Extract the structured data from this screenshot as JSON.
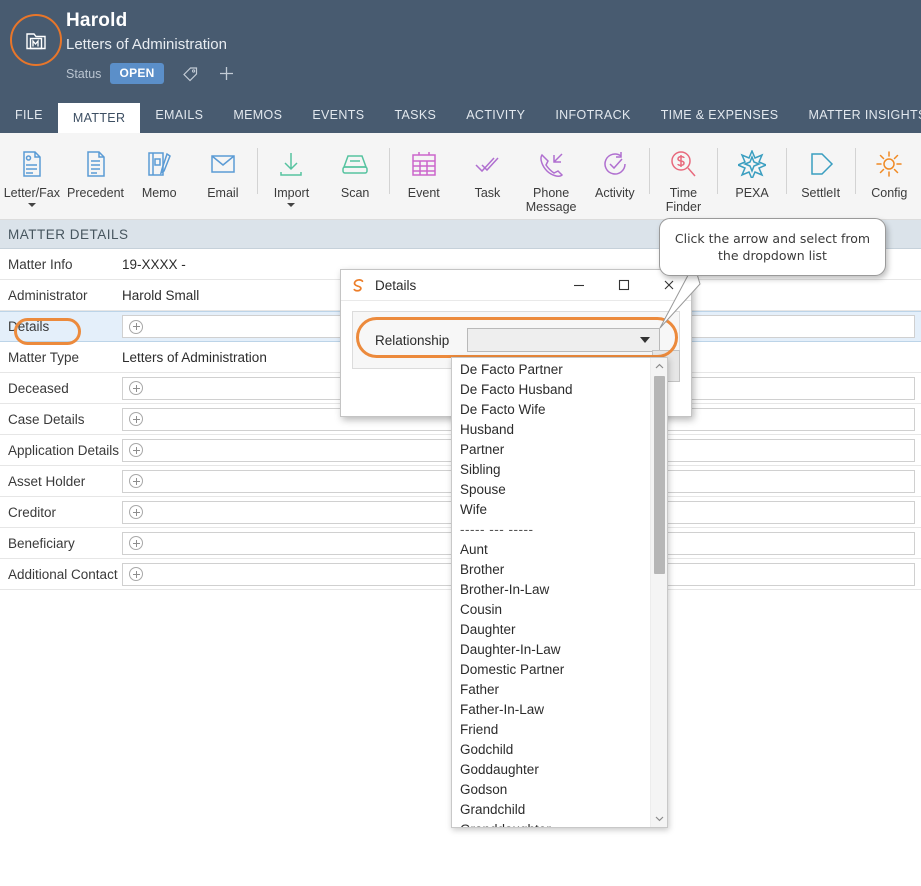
{
  "header": {
    "matter_name": "Harold",
    "matter_type": "Letters of Administration",
    "status_label": "Status",
    "status_value": "OPEN",
    "avatar_icon": "matter-folder-icon",
    "tag_icon": "tag-icon",
    "add_icon": "plus-icon",
    "bg_color": "#485b70",
    "accent_color": "#e8762a",
    "badge_color": "#5b8fc9"
  },
  "tabs": [
    {
      "label": "FILE",
      "active": false
    },
    {
      "label": "MATTER",
      "active": true
    },
    {
      "label": "EMAILS",
      "active": false
    },
    {
      "label": "MEMOS",
      "active": false
    },
    {
      "label": "EVENTS",
      "active": false
    },
    {
      "label": "TASKS",
      "active": false
    },
    {
      "label": "ACTIVITY",
      "active": false
    },
    {
      "label": "INFOTRACK",
      "active": false
    },
    {
      "label": "TIME & EXPENSES",
      "active": false
    },
    {
      "label": "MATTER INSIGHTS",
      "active": false
    }
  ],
  "ribbon": [
    {
      "label": "Letter/Fax",
      "icon": "document-letter-icon",
      "color": "#5b9bd5",
      "caret": true
    },
    {
      "label": "Precedent",
      "icon": "document-lines-icon",
      "color": "#5b9bd5",
      "caret": false
    },
    {
      "label": "Memo",
      "icon": "notebook-pen-icon",
      "color": "#5b9bd5",
      "caret": false
    },
    {
      "label": "Email",
      "icon": "envelope-icon",
      "color": "#5b9bd5",
      "caret": false
    },
    {
      "sep": true
    },
    {
      "label": "Import",
      "icon": "download-arrow-icon",
      "color": "#56c3a0",
      "caret": true
    },
    {
      "label": "Scan",
      "icon": "scanner-icon",
      "color": "#56c3a0",
      "caret": false
    },
    {
      "sep": true
    },
    {
      "label": "Event",
      "icon": "calendar-icon",
      "color": "#cc66cc",
      "caret": false
    },
    {
      "label": "Task",
      "icon": "double-check-icon",
      "color": "#b06fd0",
      "caret": false
    },
    {
      "label": "Phone Message",
      "icon": "phone-incoming-icon",
      "color": "#b06fd0",
      "caret": false
    },
    {
      "label": "Activity",
      "icon": "clock-check-icon",
      "color": "#b06fd0",
      "caret": false
    },
    {
      "sep": true
    },
    {
      "label": "Time Finder",
      "icon": "dollar-magnifier-icon",
      "color": "#e8697d",
      "caret": false
    },
    {
      "sep": true
    },
    {
      "label": "PEXA",
      "icon": "pexa-star-icon",
      "color": "#3a9ec0",
      "caret": false
    },
    {
      "sep": true
    },
    {
      "label": "SettleIt",
      "icon": "arrow-right-flag-icon",
      "color": "#3a9ec0",
      "caret": false
    },
    {
      "sep": true
    },
    {
      "label": "Config",
      "icon": "gear-icon",
      "color": "#f08a24",
      "caret": false
    }
  ],
  "matter_details": {
    "section_title": "MATTER DETAILS",
    "rows": [
      {
        "label": "Matter Info",
        "value": "19-XXXX -",
        "type": "text"
      },
      {
        "label": "Administrator",
        "value": "Harold Small",
        "type": "text"
      },
      {
        "label": "Details",
        "value": "",
        "type": "input",
        "highlighted": true,
        "annotated": true
      },
      {
        "label": "Matter Type",
        "value": "Letters of Administration",
        "type": "text"
      },
      {
        "label": "Deceased",
        "value": "",
        "type": "input"
      },
      {
        "label": "Case Details",
        "value": "",
        "type": "input"
      },
      {
        "label": "Application Details",
        "value": "",
        "type": "input"
      },
      {
        "label": "Asset Holder",
        "value": "",
        "type": "input"
      },
      {
        "label": "Creditor",
        "value": "",
        "type": "input"
      },
      {
        "label": "Beneficiary",
        "value": "",
        "type": "input"
      },
      {
        "label": "Additional Contact",
        "value": "",
        "type": "input"
      }
    ]
  },
  "dialog": {
    "title": "Details",
    "app_icon": "swirl-logo-icon",
    "minimize_icon": "minimize-icon",
    "maximize_icon": "maximize-icon",
    "close_icon": "close-icon",
    "field_label": "Relationship",
    "field_value": "",
    "field_placeholder": ""
  },
  "dropdown": {
    "items": [
      "De Facto Partner",
      "De Facto Husband",
      "De Facto Wife",
      "Husband",
      "Partner",
      "Sibling",
      "Spouse",
      "Wife",
      "----- --- -----",
      "Aunt",
      "Brother",
      "Brother-In-Law",
      "Cousin",
      "Daughter",
      "Daughter-In-Law",
      "Domestic Partner",
      "Father",
      "Father-In-Law",
      "Friend",
      "Godchild",
      "Goddaughter",
      "Godson",
      "Grandchild",
      "Granddaughter"
    ],
    "scroll_up_icon": "chevron-up-icon",
    "scroll_down_icon": "chevron-down-icon"
  },
  "callout": {
    "text": "Click the arrow and select from the dropdown list",
    "border_color": "#9a9a9a"
  }
}
